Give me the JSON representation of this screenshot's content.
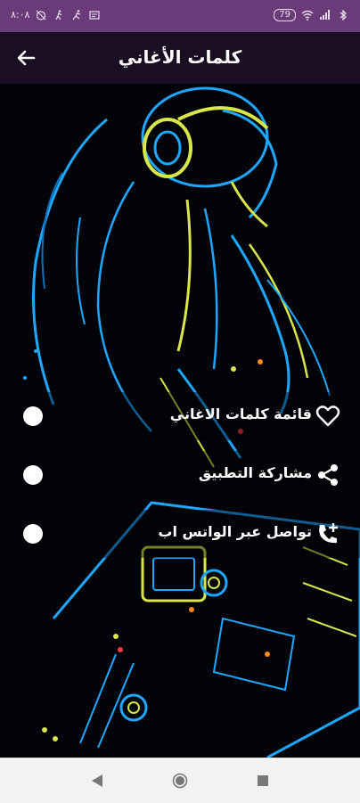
{
  "status": {
    "battery": "79",
    "time": "٨:٠٨"
  },
  "app": {
    "title": "كلمات الأغاني"
  },
  "menu": [
    {
      "label": "قائمة كلمات الاغاني",
      "icon": "heart-icon"
    },
    {
      "label": "مشاركة التطبيق",
      "icon": "share-icon"
    },
    {
      "label": "تواصل عبر الواتس اب",
      "icon": "add-call-icon"
    }
  ],
  "colors": {
    "status_bar": "#6a3b78",
    "app_bar": "#1a0f22",
    "neon_blue": "#1ea7ff",
    "neon_yellow": "#d8e64a"
  },
  "nav": [
    "back-triangle-icon",
    "home-circle-icon",
    "recents-square-icon"
  ]
}
